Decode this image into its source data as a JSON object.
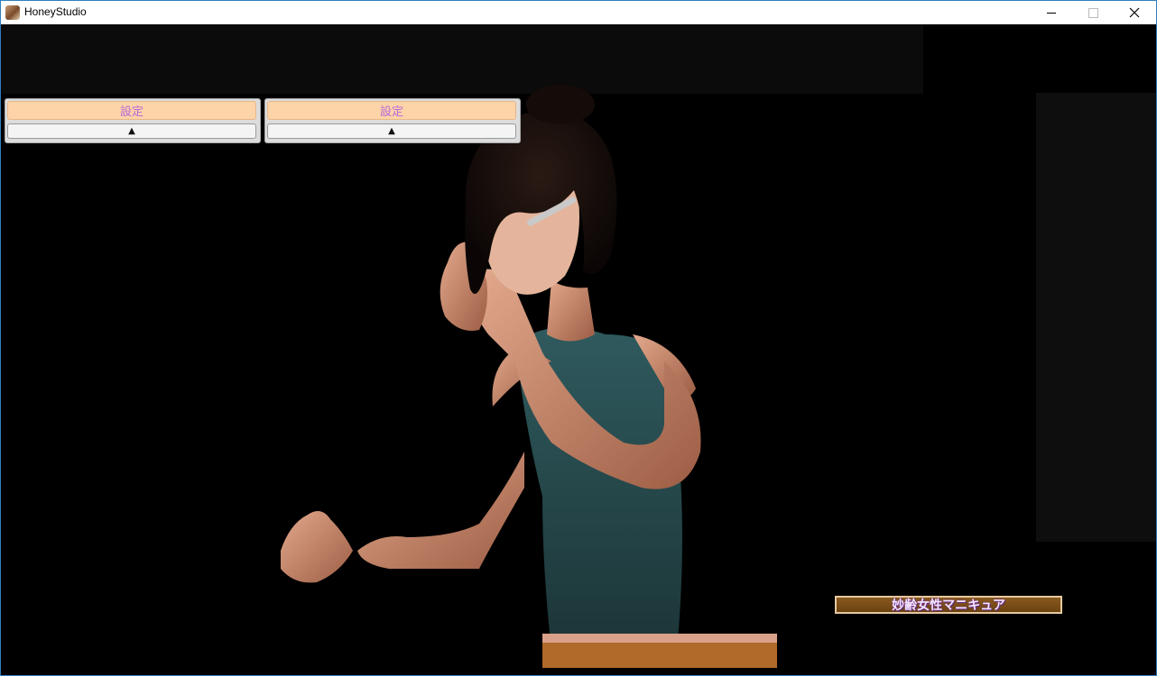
{
  "window": {
    "title": "HoneyStudio",
    "controls": {
      "minimize": "—",
      "maximize": "☐",
      "close": "✕"
    }
  },
  "panels": [
    {
      "settings_label": "設定",
      "collapse_glyph": "▲"
    },
    {
      "settings_label": "設定",
      "collapse_glyph": "▲"
    }
  ],
  "scene": {
    "overlay_label": "妙齢女性マニキュア"
  },
  "icons": {
    "app": "honeystudio-app-icon",
    "collapse": "triangle-up-icon"
  },
  "colors": {
    "settings_button_bg": "#fdd3a8",
    "settings_button_text": "#b96ad8",
    "overlay_label_bg": "#7a4c16",
    "overlay_label_text": "#f3e6ff",
    "window_border": "#2f7fc1"
  }
}
